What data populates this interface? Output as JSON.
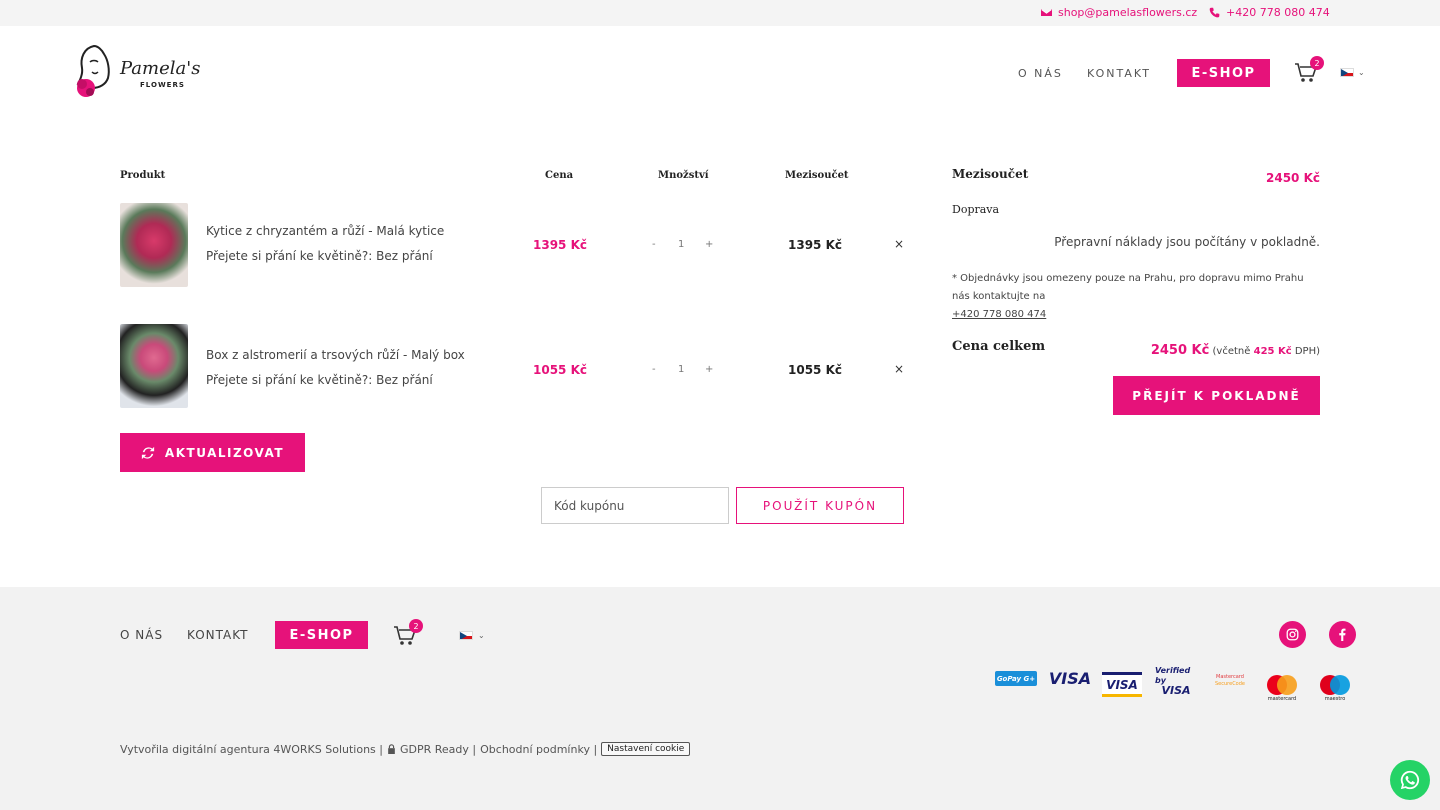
{
  "topbar": {
    "email": "shop@pamelasflowers.cz",
    "phone": "+420 778 080 474"
  },
  "header": {
    "logo_title": "Pamela's",
    "logo_subtitle": "FLOWERS",
    "nav_about": "O NÁS",
    "nav_contact": "KONTAKT",
    "nav_eshop": "E-SHOP",
    "cart_count": "2",
    "language": "cs"
  },
  "cart": {
    "headers": {
      "product": "Produkt",
      "price": "Cena",
      "quantity": "Množství",
      "subtotal": "Mezisoučet"
    },
    "items": [
      {
        "name": "Kytice z chryzantém a růží - Malá kytice",
        "option": "Přejete si přání ke květině?: Bez přání",
        "price": "1395 Kč",
        "qty_minus": "-",
        "qty": "1",
        "qty_plus": "+",
        "subtotal": "1395 Kč",
        "remove": "×"
      },
      {
        "name": "Box z alstromerií a trsových růží - Malý box",
        "option": "Přejete si přání ke květině?: Bez přání",
        "price": "1055 Kč",
        "qty_minus": "-",
        "qty": "1",
        "qty_plus": "+",
        "subtotal": "1055 Kč",
        "remove": "×"
      }
    ],
    "update_button": "AKTUALIZOVAT",
    "coupon_placeholder": "Kód kupónu",
    "coupon_button": "POUŽÍT KUPÓN"
  },
  "totals": {
    "subtotal_label": "Mezisoučet",
    "subtotal_value": "2450 Kč",
    "shipping_label": "Doprava",
    "shipping_note": "Přepravní náklady jsou počítány v pokladně.",
    "shipping_info": "* Objednávky jsou omezeny pouze na Prahu, pro dopravu mimo Prahu nás kontaktujte na",
    "shipping_phone": "+420 778 080 474",
    "total_label": "Cena celkem",
    "total_value": "2450 Kč",
    "vat_prefix": "(včetně",
    "vat_value": "425 Kč",
    "vat_suffix": "DPH)",
    "checkout_button": "PŘEJÍT K POKLADNĚ"
  },
  "footer": {
    "nav_about": "O NÁS",
    "nav_contact": "KONTAKT",
    "nav_eshop": "E-SHOP",
    "cart_count": "2",
    "payments": {
      "gopay": "GoPay G+",
      "visa": "VISA",
      "visa_electron": "VISA",
      "verified_visa_1": "Verified by",
      "verified_visa_2": "VISA",
      "mastercard_securecode_1": "Mastercard",
      "mastercard_securecode_2": "SecureCode",
      "mastercard": "mastercard",
      "maestro": "maestro"
    },
    "credits_agency": "Vytvořila digitální agentura 4WORKS Solutions |",
    "credits_gdpr": "GDPR Ready |",
    "credits_terms": "Obchodní podmínky |",
    "cookie_button": "Nastavení cookie"
  },
  "colors": {
    "accent": "#e6127a",
    "footer_bg": "#f2f2f2",
    "whatsapp": "#25d366"
  }
}
